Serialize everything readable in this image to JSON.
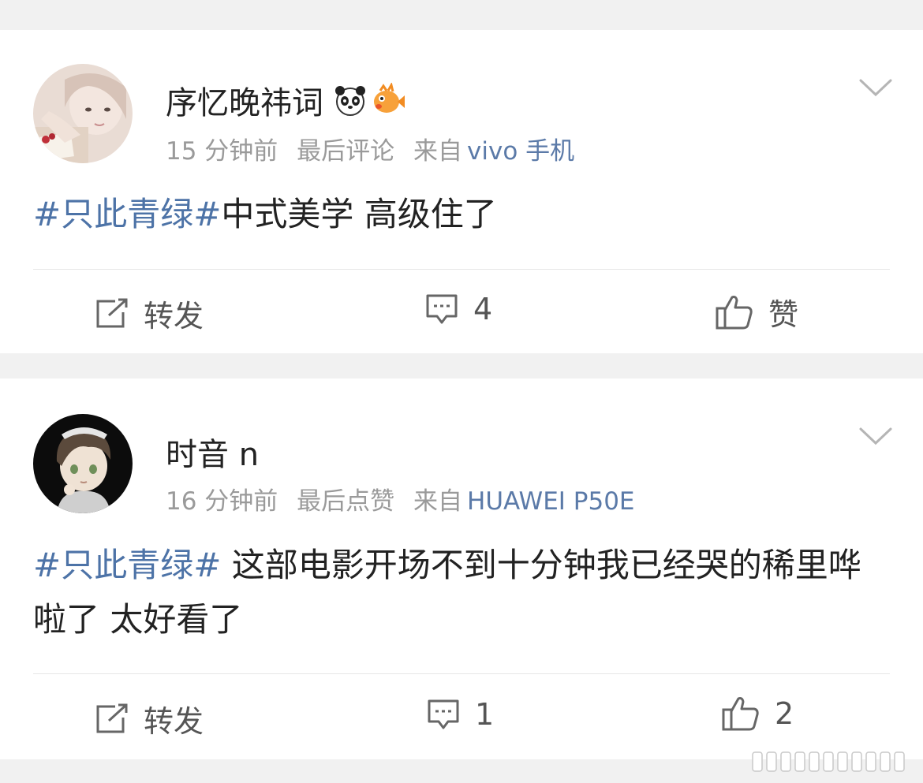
{
  "posts": [
    {
      "username": "序忆晚祎词",
      "badges": [
        "panda-icon",
        "puffer-fish-icon"
      ],
      "time": "15 分钟前",
      "activity": "最后评论",
      "source_prefix": "来自",
      "source": "vivo 手机",
      "topic": "#只此青绿#",
      "text": "中式美学 高级住了",
      "actions": {
        "repost_label": "转发",
        "comment_count": "4",
        "like_label": "赞"
      }
    },
    {
      "username": "时音 n",
      "badges": [],
      "time": "16 分钟前",
      "activity": "最后点赞",
      "source_prefix": "来自",
      "source": "HUAWEI P50E",
      "topic": "#只此青绿#",
      "text": " 这部电影开场不到十分钟我已经哭的稀里哗啦了  太好看了",
      "actions": {
        "repost_label": "转发",
        "comment_count": "1",
        "like_label": "2"
      }
    }
  ],
  "colors": {
    "topic": "#4d73a7",
    "source": "#5b7aa8",
    "meta": "#9a9a9a",
    "separator": "#f1f1f1"
  }
}
